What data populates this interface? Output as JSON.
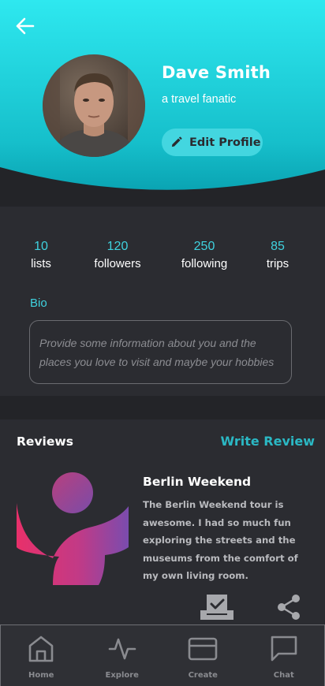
{
  "header": {
    "back_icon": "arrow-left-icon",
    "user": {
      "name": "Dave Smith",
      "tagline": "a travel fanatic"
    },
    "edit_button": {
      "icon": "pencil-icon",
      "label": "Edit Profile"
    }
  },
  "stats": [
    {
      "value": "10",
      "label": "lists"
    },
    {
      "value": "120",
      "label": "followers"
    },
    {
      "value": "250",
      "label": "following"
    },
    {
      "value": "85",
      "label": "trips"
    }
  ],
  "bio": {
    "label": "Bio",
    "placeholder": "Provide some information about you and the places you love to visit and maybe your hobbies"
  },
  "reviews": {
    "title": "Reviews",
    "write_label": "Write Review",
    "items": [
      {
        "title": "Berlin Weekend",
        "body": "The Berlin Weekend tour is awesome. I had so much fun exploring the streets and the museums from the comfort of my own living room.",
        "actions": [
          "save-icon",
          "share-icon"
        ]
      }
    ]
  },
  "nav": [
    {
      "label": "Home",
      "icon": "home-icon"
    },
    {
      "label": "Explore",
      "icon": "activity-icon"
    },
    {
      "label": "Create",
      "icon": "card-icon"
    },
    {
      "label": "Chat",
      "icon": "chat-icon"
    }
  ],
  "colors": {
    "accent": "#3fd2df",
    "header_gradient_top": "#2ee6ee",
    "header_gradient_bottom": "#0aa7b5",
    "background": "#2b2c31",
    "edit_button": "#43d6e0"
  }
}
